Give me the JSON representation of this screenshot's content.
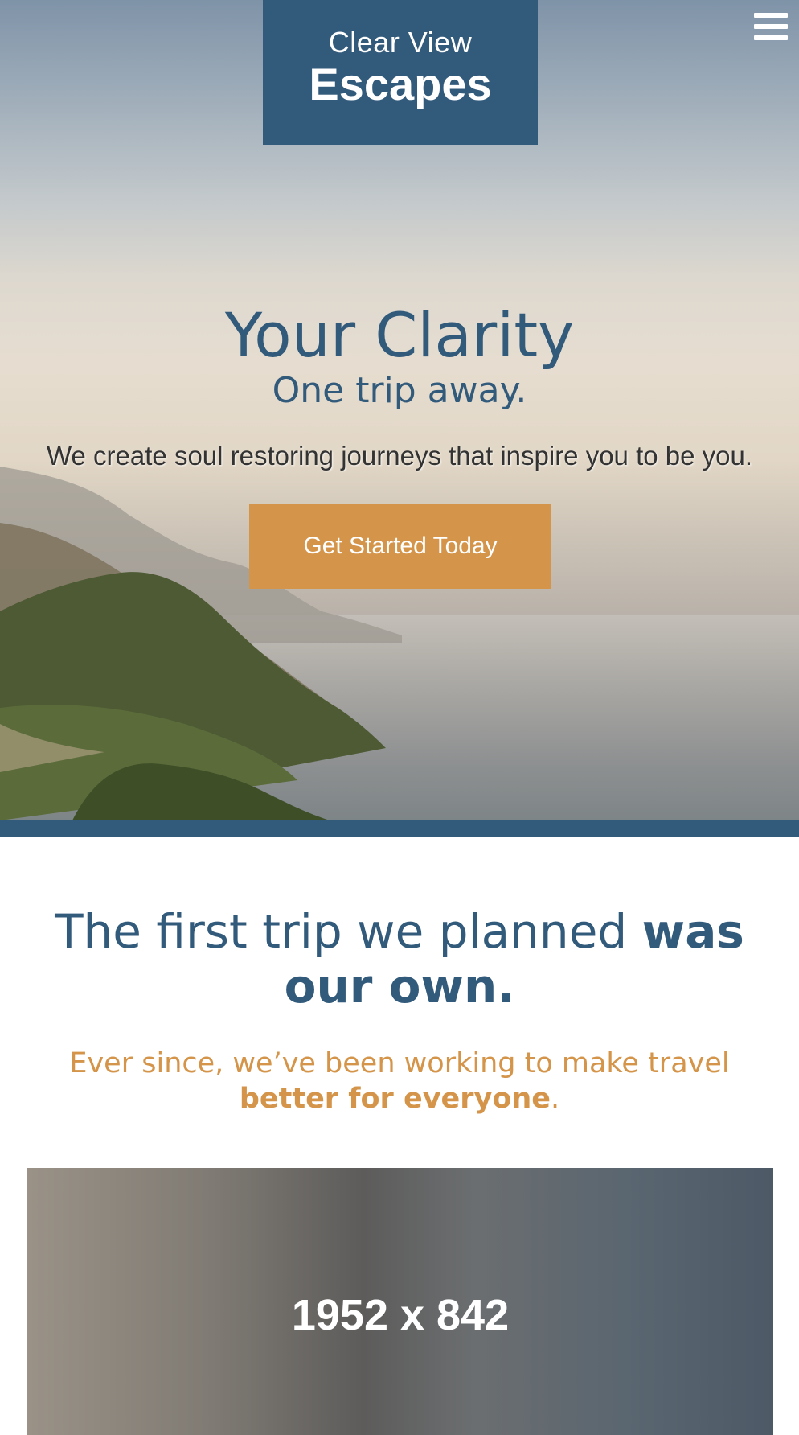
{
  "header": {
    "logo_line1": "Clear View",
    "logo_line2": "Escapes",
    "menu_icon": "hamburger-menu-icon"
  },
  "hero": {
    "title": "Your Clarity",
    "subtitle": "One trip away.",
    "tagline": "We create soul restoring journeys that inspire you to be you.",
    "cta_label": "Get Started Today"
  },
  "about": {
    "heading_regular": "The first trip we planned ",
    "heading_bold": "was our own.",
    "sub_regular": "Ever since, we’ve been working to make travel ",
    "sub_bold": "better for everyone",
    "sub_end": "."
  },
  "image_placeholder": {
    "label": "1952 x 842"
  },
  "colors": {
    "brand_blue": "#325a7b",
    "accent_orange": "#d4954a"
  }
}
